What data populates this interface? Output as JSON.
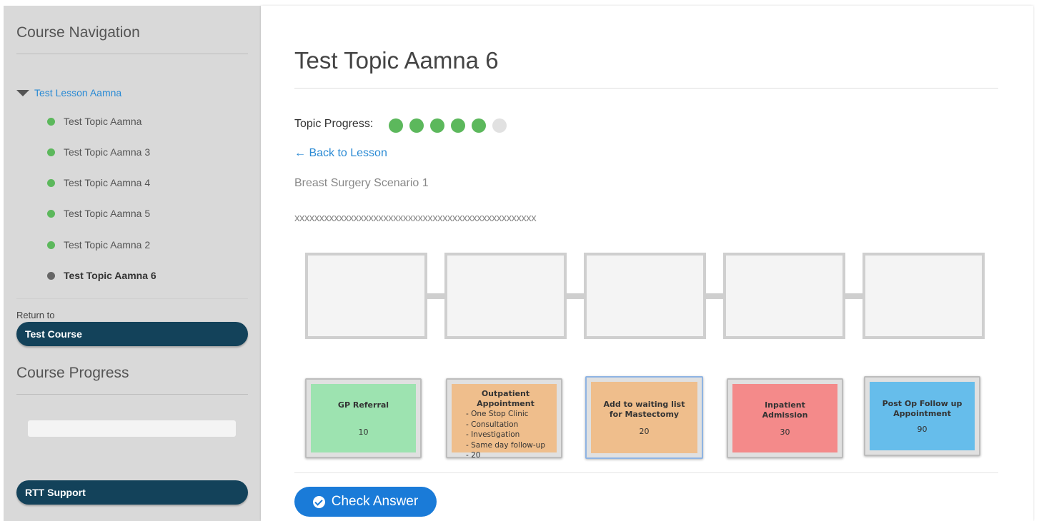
{
  "sidebar": {
    "nav_title": "Course Navigation",
    "lesson": "Test Lesson Aamna",
    "topics": [
      {
        "label": "Test Topic Aamna",
        "status": "complete"
      },
      {
        "label": "Test Topic Aamna 3",
        "status": "complete"
      },
      {
        "label": "Test Topic Aamna 4",
        "status": "complete"
      },
      {
        "label": "Test Topic Aamna 5",
        "status": "complete"
      },
      {
        "label": "Test Topic Aamna 2",
        "status": "complete"
      },
      {
        "label": "Test Topic Aamna 6",
        "status": "current"
      }
    ],
    "return_to": "Return to",
    "course_button": "Test Course",
    "progress_title": "Course Progress",
    "support_button": "RTT Support"
  },
  "main": {
    "title": "Test Topic Aamna 6",
    "topic_progress_label": "Topic Progress:",
    "topic_progress": {
      "completed": 5,
      "total": 6
    },
    "back_link": "← Back to Lesson",
    "scenario": "Breast Surgery Scenario 1",
    "placeholder_text": "xxxxxxxxxxxxxxxxxxxxxxxxxxxxxxxxxxxxxxxxxxxxxxxxx",
    "drop_slots": 5,
    "cards": [
      {
        "title": "GP Referral",
        "value": "10",
        "color": "#9de3b0"
      },
      {
        "title": "Outpatient Appointment",
        "items": [
          "- One Stop Clinic",
          "- Consultation",
          "- Investigation",
          "- Same day follow-up",
          "- 20"
        ],
        "color": "#efbe8c"
      },
      {
        "title": "Add to waiting list for Mastectomy",
        "value": "20",
        "color": "#efbe8c"
      },
      {
        "title": "Inpatient Admission",
        "value": "30",
        "color": "#f48a8a"
      },
      {
        "title": "Post Op Follow up Appointment",
        "value": "90",
        "color": "#66bdeb"
      }
    ],
    "check_button": "Check Answer"
  }
}
